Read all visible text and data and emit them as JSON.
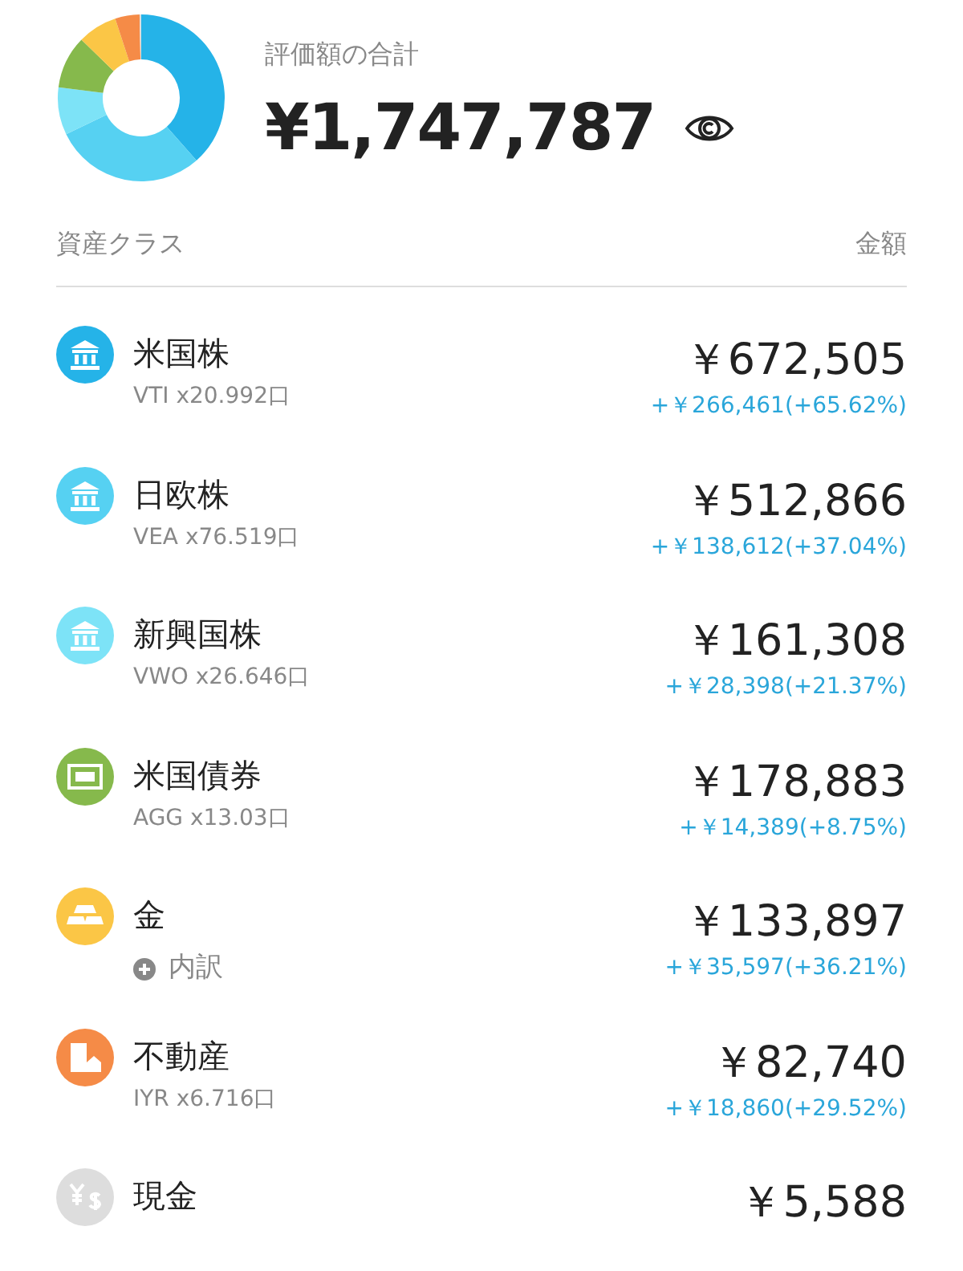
{
  "summary": {
    "label": "評価額の合計",
    "total": "¥1,747,787"
  },
  "header": {
    "class_label": "資産クラス",
    "amount_label": "金額"
  },
  "assets": [
    {
      "kind": "bank",
      "color": "#25b3e8",
      "name": "米国株",
      "detail": "VTI x20.992口",
      "amount": "￥672,505",
      "gain": "+￥266,461(+65.62%)"
    },
    {
      "kind": "bank",
      "color": "#56d1f2",
      "name": "日欧株",
      "detail": "VEA x76.519口",
      "amount": "￥512,866",
      "gain": "+￥138,612(+37.04%)"
    },
    {
      "kind": "bank",
      "color": "#7de3f7",
      "name": "新興国株",
      "detail": "VWO x26.646口",
      "amount": "￥161,308",
      "gain": "+￥28,398(+21.37%)"
    },
    {
      "kind": "bill",
      "color": "#86b94c",
      "name": "米国債券",
      "detail": "AGG x13.03口",
      "amount": "￥178,883",
      "gain": "+￥14,389(+8.75%)"
    },
    {
      "kind": "gold",
      "color": "#fbc646",
      "name": "金",
      "breakdown": "内訳",
      "amount": "￥133,897",
      "gain": "+￥35,597(+36.21%)"
    },
    {
      "kind": "building",
      "color": "#f58b47",
      "name": "不動産",
      "detail": "IYR x6.716口",
      "amount": "￥82,740",
      "gain": "+￥18,860(+29.52%)"
    },
    {
      "kind": "cash",
      "color": "#dddddd",
      "name": "現金",
      "amount": "￥5,588"
    }
  ]
}
